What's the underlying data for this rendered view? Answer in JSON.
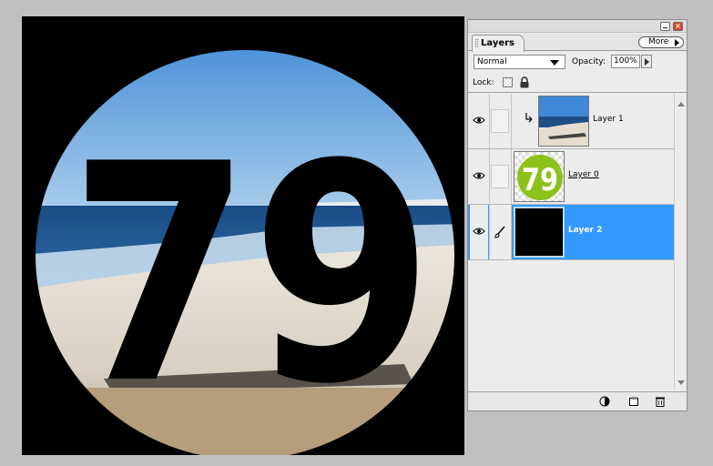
{
  "palette": {
    "close_glyph": "×",
    "tab_label": "Layers",
    "more_label": "More",
    "blend_mode": "Normal",
    "opacity_label": "Opacity:",
    "opacity_value": "100%",
    "lock_label": "Lock:",
    "layers": [
      {
        "name": "Layer 1",
        "visible": true,
        "clipped": true,
        "selected": false,
        "thumb": "beach-photo"
      },
      {
        "name": "Layer 0",
        "visible": true,
        "clipped": false,
        "selected": false,
        "thumb": "green-79-logo"
      },
      {
        "name": "Layer 2",
        "visible": true,
        "clipped": false,
        "selected": true,
        "thumb": "black-fill"
      }
    ]
  },
  "canvas": {
    "number_text": "79"
  },
  "colors": {
    "selection": "#3399ff",
    "logo_green": "#8cc21a",
    "sky": "#4a8fd8",
    "ocean": "#1e4f86",
    "sand": "#d6cfc2"
  },
  "icons": {
    "visibility": "eye-icon",
    "brush": "brush-icon",
    "lock_transparency": "lock-transparency-icon",
    "lock_all": "padlock-icon",
    "adjustment": "adjustment-layer-icon",
    "new_layer": "new-layer-icon",
    "delete": "trash-icon"
  }
}
